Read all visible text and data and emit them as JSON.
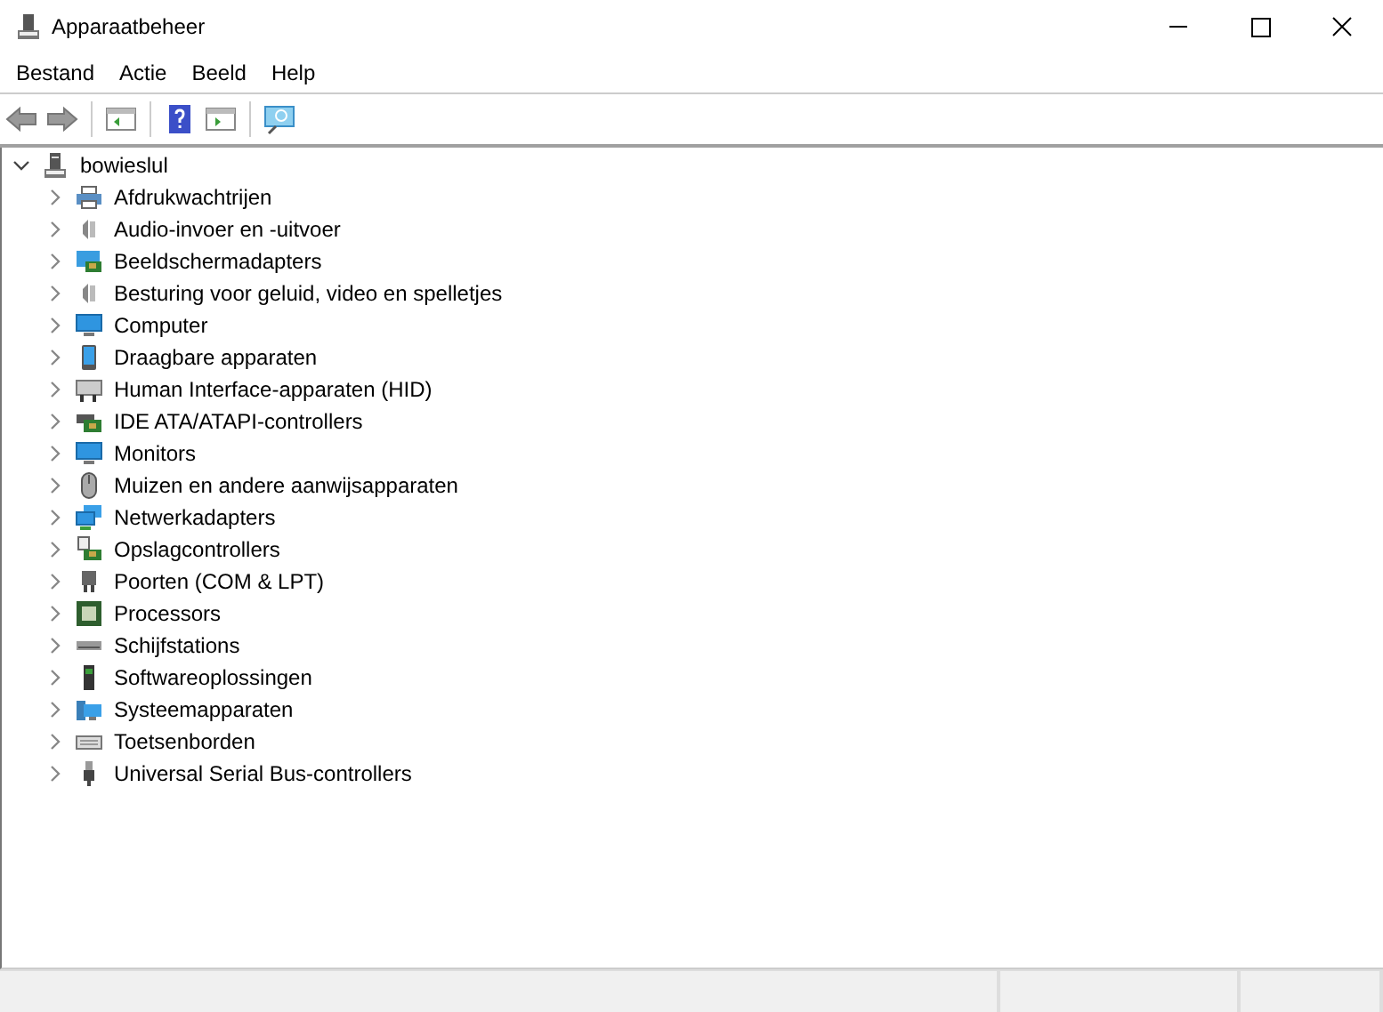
{
  "window": {
    "title": "Apparaatbeheer"
  },
  "menu": [
    "Bestand",
    "Actie",
    "Beeld",
    "Help"
  ],
  "tree": {
    "label": "bowieslul",
    "kind": "computer-tower",
    "expanded": true,
    "children": [
      {
        "label": "Afdrukwachtrijen",
        "kind": "printer",
        "expanded": false
      },
      {
        "label": "Audio-invoer en -uitvoer",
        "kind": "speaker",
        "expanded": false
      },
      {
        "label": "Beeldschermadapters",
        "kind": "display-card",
        "expanded": false
      },
      {
        "label": "Besturing voor geluid, video en spelletjes",
        "kind": "speaker",
        "expanded": false
      },
      {
        "label": "Computer",
        "kind": "monitor",
        "expanded": false
      },
      {
        "label": "Draagbare apparaten",
        "kind": "tablet",
        "expanded": false
      },
      {
        "label": "Human Interface-apparaten (HID)",
        "kind": "hid",
        "expanded": false
      },
      {
        "label": "IDE ATA/ATAPI-controllers",
        "kind": "board",
        "expanded": false
      },
      {
        "label": "Monitors",
        "kind": "monitor",
        "expanded": false
      },
      {
        "label": "Muizen en andere aanwijsapparaten",
        "kind": "mouse",
        "expanded": false
      },
      {
        "label": "Netwerkadapters",
        "kind": "network",
        "expanded": false
      },
      {
        "label": "Opslagcontrollers",
        "kind": "storage",
        "expanded": false
      },
      {
        "label": "Poorten (COM & LPT)",
        "kind": "port",
        "expanded": false
      },
      {
        "label": "Processors",
        "kind": "chip",
        "expanded": false
      },
      {
        "label": "Schijfstations",
        "kind": "drive",
        "expanded": false
      },
      {
        "label": "Softwareoplossingen",
        "kind": "tower",
        "expanded": false
      },
      {
        "label": "Systeemapparaten",
        "kind": "system",
        "expanded": false
      },
      {
        "label": "Toetsenborden",
        "kind": "keyboard",
        "expanded": false
      },
      {
        "label": "Universal Serial Bus-controllers",
        "kind": "usb",
        "expanded": false
      }
    ]
  }
}
